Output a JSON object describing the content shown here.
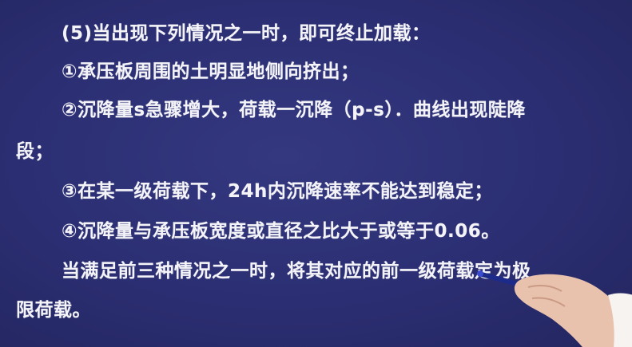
{
  "lines": [
    "(5)当出现下列情况之一时，即可终止加载：",
    "①承压板周围的土明显地侧向挤出；",
    "②沉降量s急骤增大，荷载一沉降（p-s）．曲线出现陡降",
    "段；",
    "③在某一级荷载下，24h内沉降速率不能达到稳定；",
    "④沉降量与承压板宽度或直径之比大于或等于0.06。",
    "当满足前三种情况之一时，将其对应的前一级荷载定为极",
    "限荷载。"
  ],
  "colors": {
    "background": "#2b2e72",
    "text": "#f4f4f8"
  }
}
